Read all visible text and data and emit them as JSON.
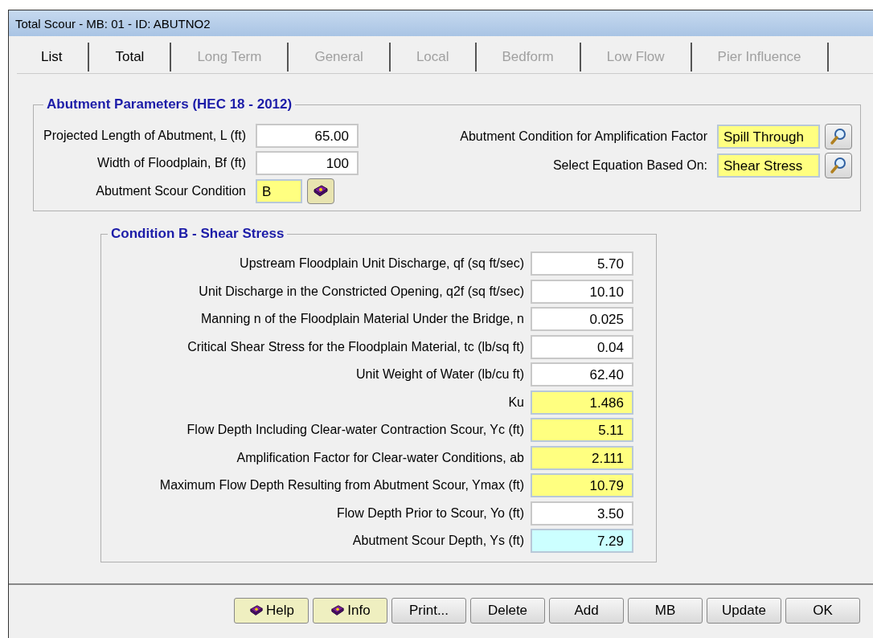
{
  "window": {
    "title": "Total Scour - MB: 01 - ID: ABUTNO2"
  },
  "tabs": [
    {
      "label": "List",
      "disabled": false
    },
    {
      "label": "Total",
      "disabled": false
    },
    {
      "label": "Long Term",
      "disabled": true
    },
    {
      "label": "General",
      "disabled": true
    },
    {
      "label": "Local",
      "disabled": true
    },
    {
      "label": "Bedform",
      "disabled": true
    },
    {
      "label": "Low Flow",
      "disabled": true
    },
    {
      "label": "Pier Influence",
      "disabled": true
    }
  ],
  "parameters": {
    "title": "Abutment Parameters (HEC 18 - 2012)",
    "projected_length": {
      "label": "Projected Length of Abutment, L (ft)",
      "value": "65.00"
    },
    "floodplain_width": {
      "label": "Width of Floodplain, Bf (ft)",
      "value": "100"
    },
    "scour_condition": {
      "label": "Abutment Scour Condition",
      "value": "B"
    },
    "amplification_condition": {
      "label": "Abutment Condition for Amplification Factor",
      "value": "Spill Through"
    },
    "equation_basis": {
      "label": "Select Equation Based On:",
      "value": "Shear Stress"
    }
  },
  "condition": {
    "title": "Condition B - Shear Stress",
    "rows": [
      {
        "label": "Upstream Floodplain Unit Discharge, qf (sq ft/sec)",
        "value": "5.70",
        "kind": "input"
      },
      {
        "label": "Unit Discharge in the Constricted Opening, q2f (sq ft/sec)",
        "value": "10.10",
        "kind": "input"
      },
      {
        "label": "Manning n of the Floodplain Material Under the Bridge, n",
        "value": "0.025",
        "kind": "input"
      },
      {
        "label": "Critical Shear Stress for the Floodplain Material, tc (lb/sq ft)",
        "value": "0.04",
        "kind": "input"
      },
      {
        "label": "Unit Weight of Water (lb/cu ft)",
        "value": "62.40",
        "kind": "input"
      },
      {
        "label": "Ku",
        "value": "1.486",
        "kind": "computed"
      },
      {
        "label": "Flow Depth Including Clear-water Contraction Scour, Yc (ft)",
        "value": "5.11",
        "kind": "computed"
      },
      {
        "label": "Amplification Factor for Clear-water Conditions, ab",
        "value": "2.111",
        "kind": "computed"
      },
      {
        "label": "Maximum Flow Depth Resulting from Abutment Scour, Ymax (ft)",
        "value": "10.79",
        "kind": "computed"
      },
      {
        "label": "Flow Depth Prior to Scour, Yo (ft)",
        "value": "3.50",
        "kind": "input"
      },
      {
        "label": "Abutment Scour Depth, Ys (ft)",
        "value": "7.29",
        "kind": "result"
      }
    ]
  },
  "buttons": [
    {
      "label": "Help",
      "kind": "book"
    },
    {
      "label": "Info",
      "kind": "book"
    },
    {
      "label": "Print...",
      "kind": "plain"
    },
    {
      "label": "Delete",
      "kind": "plain"
    },
    {
      "label": "Add",
      "kind": "plain"
    },
    {
      "label": "MB",
      "kind": "plain"
    },
    {
      "label": "Update",
      "kind": "plain"
    },
    {
      "label": "OK",
      "kind": "plain"
    }
  ]
}
